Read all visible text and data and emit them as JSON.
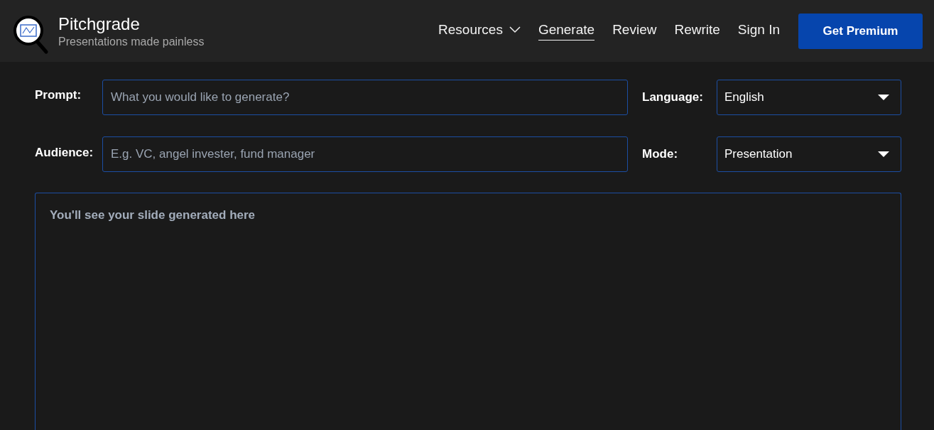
{
  "brand": {
    "name": "Pitchgrade",
    "tagline": "Presentations made painless"
  },
  "nav": [
    {
      "label": "Resources",
      "kind": "dropdown",
      "selected": false
    },
    {
      "label": "Generate",
      "kind": "link",
      "selected": true
    },
    {
      "label": "Review",
      "kind": "link",
      "selected": false
    },
    {
      "label": "Rewrite",
      "kind": "link",
      "selected": false
    },
    {
      "label": "Sign In",
      "kind": "link",
      "selected": false
    }
  ],
  "premium_button": "Get Premium",
  "form": [
    {
      "label": "Prompt:",
      "placeholder": "What you would like to generate?",
      "select_label": "Language:",
      "select_value": "English"
    },
    {
      "label": "Audience:",
      "placeholder": "E.g. VC, angel invester, fund manager",
      "select_label": "Mode:",
      "select_value": "Presentation"
    }
  ],
  "output": {
    "placeholder": "You'll see your slide generated here"
  }
}
